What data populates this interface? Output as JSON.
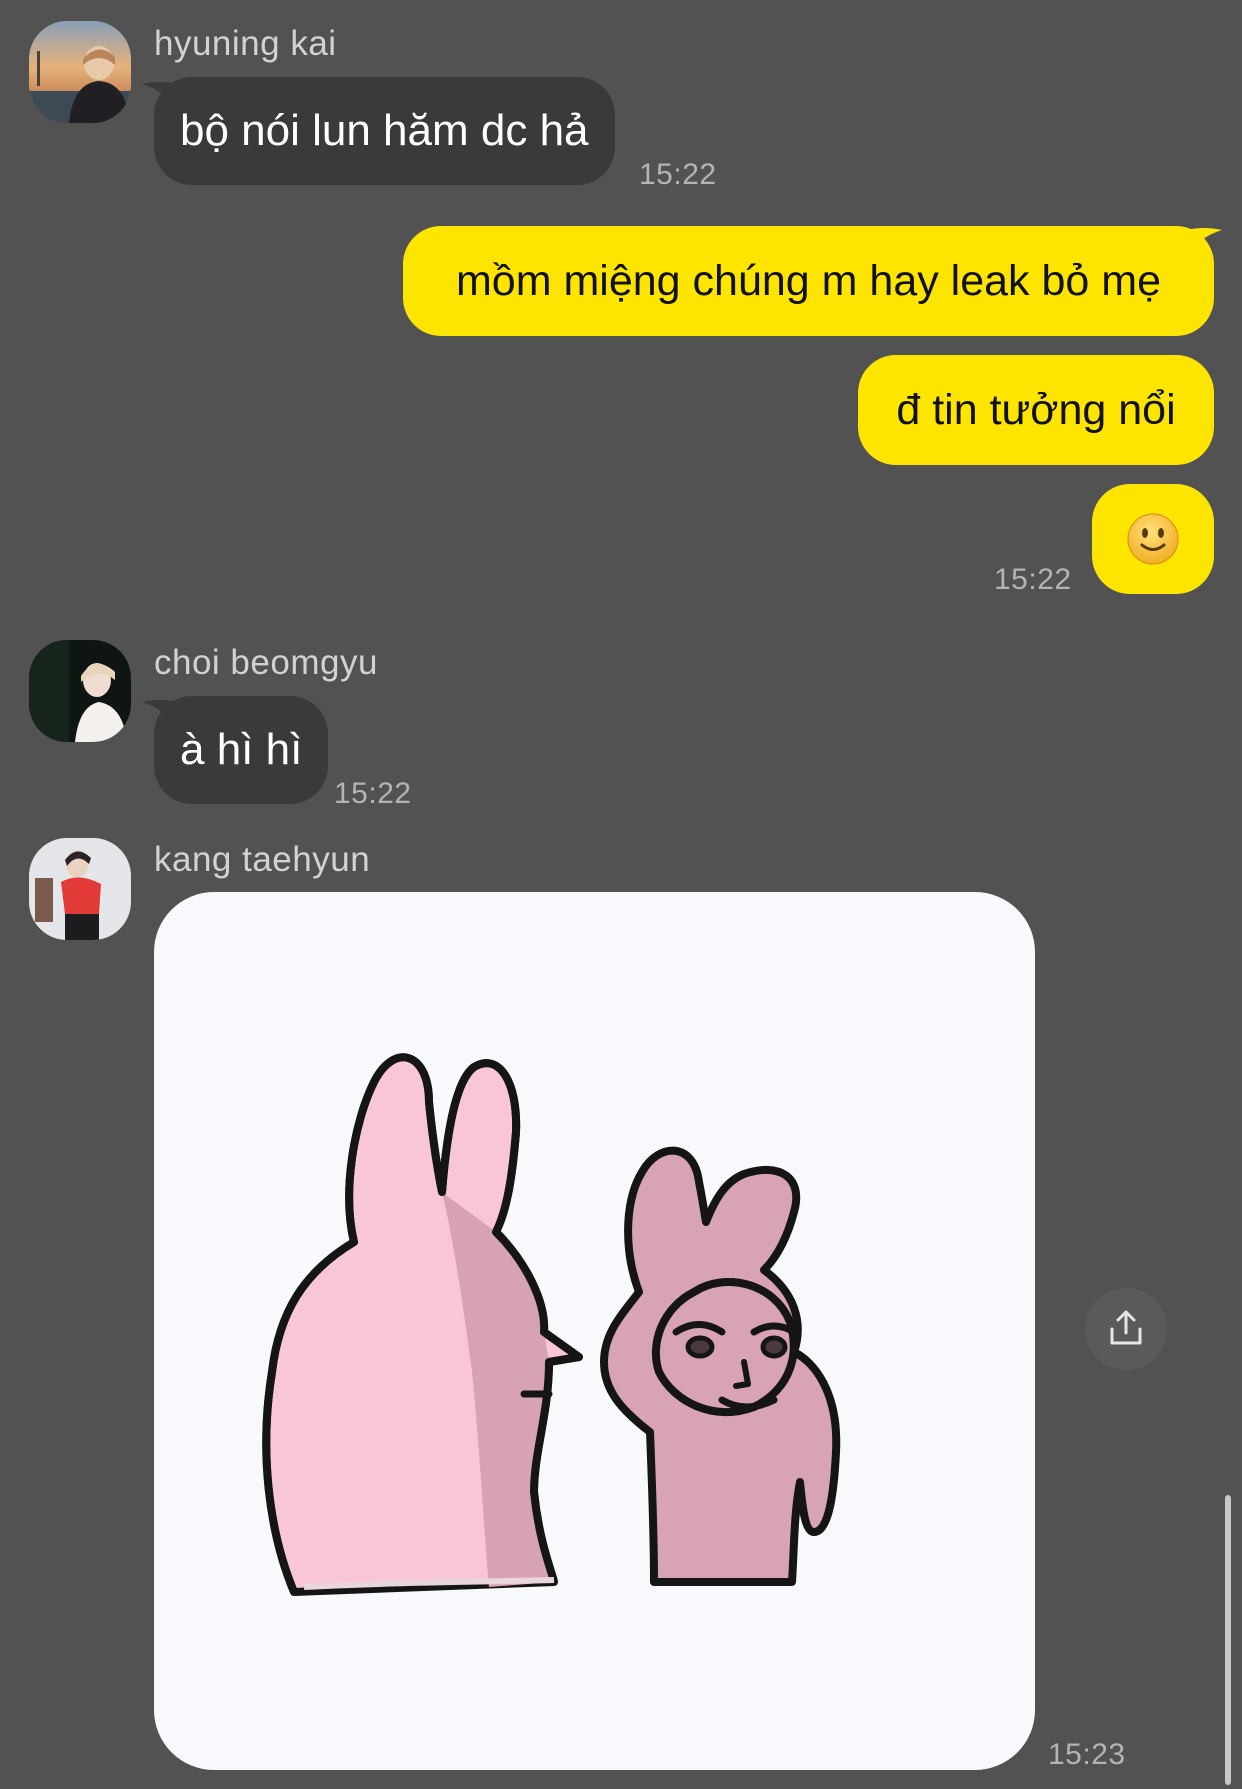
{
  "messages": [
    {
      "sender": "hyuning kai",
      "text": "bộ nói lun hăm dc hả",
      "time": "15:22"
    },
    {
      "text": "mồm miệng chúng m hay leak bỏ mẹ"
    },
    {
      "text": "đ tin tưởng nổi"
    },
    {
      "emoji": "🙂",
      "time": "15:22"
    },
    {
      "sender": "choi beomgyu",
      "text": "à hì hì",
      "time": "15:22"
    },
    {
      "sender": "kang taehyun",
      "sticker": "pink-rabbits-sticker",
      "time": "15:23"
    }
  ],
  "colors": {
    "background": "#535253",
    "incoming_bubble": "#3a3a3b",
    "outgoing_bubble": "#fee500"
  }
}
